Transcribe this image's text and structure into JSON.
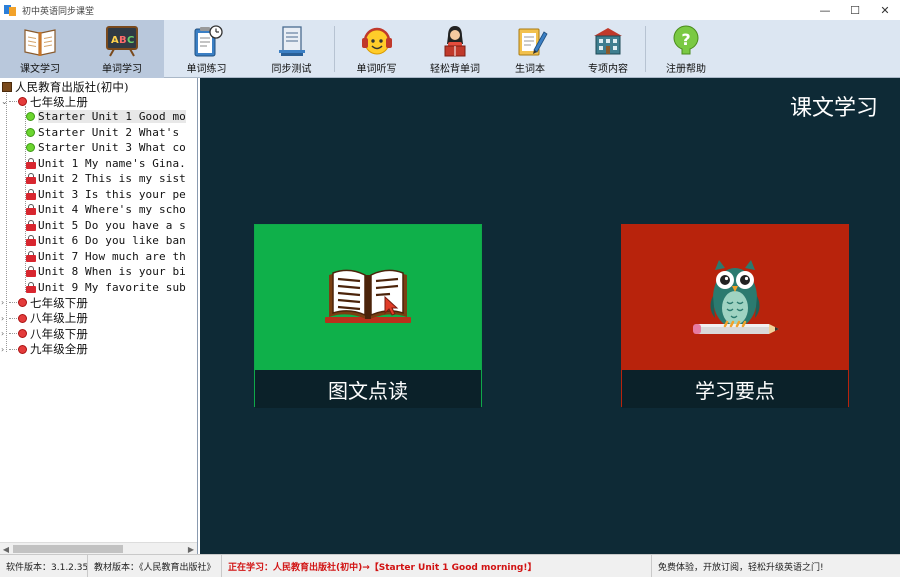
{
  "window": {
    "title": "初中英语同步课堂",
    "minimize": "—",
    "maximize": "☐",
    "close": "✕"
  },
  "toolbar": {
    "items": [
      {
        "label": "课文学习",
        "icon": "textbook-icon",
        "active": true
      },
      {
        "label": "单词学习",
        "icon": "abc-board-icon",
        "active": true
      },
      {
        "label": "单词练习",
        "icon": "clipboard-clock-icon",
        "active": false
      },
      {
        "label": "同步测试",
        "icon": "book-stack-icon",
        "active": false
      },
      {
        "label": "单词听写",
        "icon": "headphones-smiley-icon",
        "active": false
      },
      {
        "label": "轻松背单词",
        "icon": "girl-reading-icon",
        "active": false
      },
      {
        "label": "生词本",
        "icon": "notebook-pen-icon",
        "active": false
      },
      {
        "label": "专项内容",
        "icon": "school-building-icon",
        "active": false
      },
      {
        "label": "注册帮助",
        "icon": "help-question-icon",
        "active": false
      }
    ]
  },
  "tree": {
    "root": "人民教育出版社(初中)",
    "grade_open": "七年级上册",
    "units": [
      {
        "label": "Starter Unit 1 Good mo",
        "status": "unlocked",
        "selected": true
      },
      {
        "label": "Starter Unit 2 What's",
        "status": "unlocked",
        "selected": false
      },
      {
        "label": "Starter Unit 3 What co",
        "status": "unlocked",
        "selected": false
      },
      {
        "label": "Unit 1 My name's Gina.",
        "status": "locked",
        "selected": false
      },
      {
        "label": "Unit 2 This is my sist",
        "status": "locked",
        "selected": false
      },
      {
        "label": "Unit 3 Is this your pe",
        "status": "locked",
        "selected": false
      },
      {
        "label": "Unit 4 Where's my scho",
        "status": "locked",
        "selected": false
      },
      {
        "label": "Unit 5 Do you have a s",
        "status": "locked",
        "selected": false
      },
      {
        "label": "Unit 6 Do you like ban",
        "status": "locked",
        "selected": false
      },
      {
        "label": "Unit 7 How much are th",
        "status": "locked",
        "selected": false
      },
      {
        "label": "Unit 8 When is your bi",
        "status": "locked",
        "selected": false
      },
      {
        "label": "Unit 9 My favorite sub",
        "status": "locked",
        "selected": false
      }
    ],
    "grades_collapsed": [
      "七年级下册",
      "八年级上册",
      "八年级下册",
      "九年级全册"
    ]
  },
  "main": {
    "title": "课文学习",
    "cards": [
      {
        "label": "图文点读",
        "icon": "open-book-cursor-icon",
        "color": "#0fb04a"
      },
      {
        "label": "学习要点",
        "icon": "owl-pencil-icon",
        "color": "#b8230c"
      }
    ]
  },
  "statusbar": {
    "version": "软件版本：3.1.2.35",
    "edition": "教材版本：《人民教育出版社》",
    "studying": "正在学习：人民教育出版社(初中)→【Starter Unit 1 Good morning!】",
    "slogan": "免费体验，开放订阅，轻松升级英语之门!"
  }
}
